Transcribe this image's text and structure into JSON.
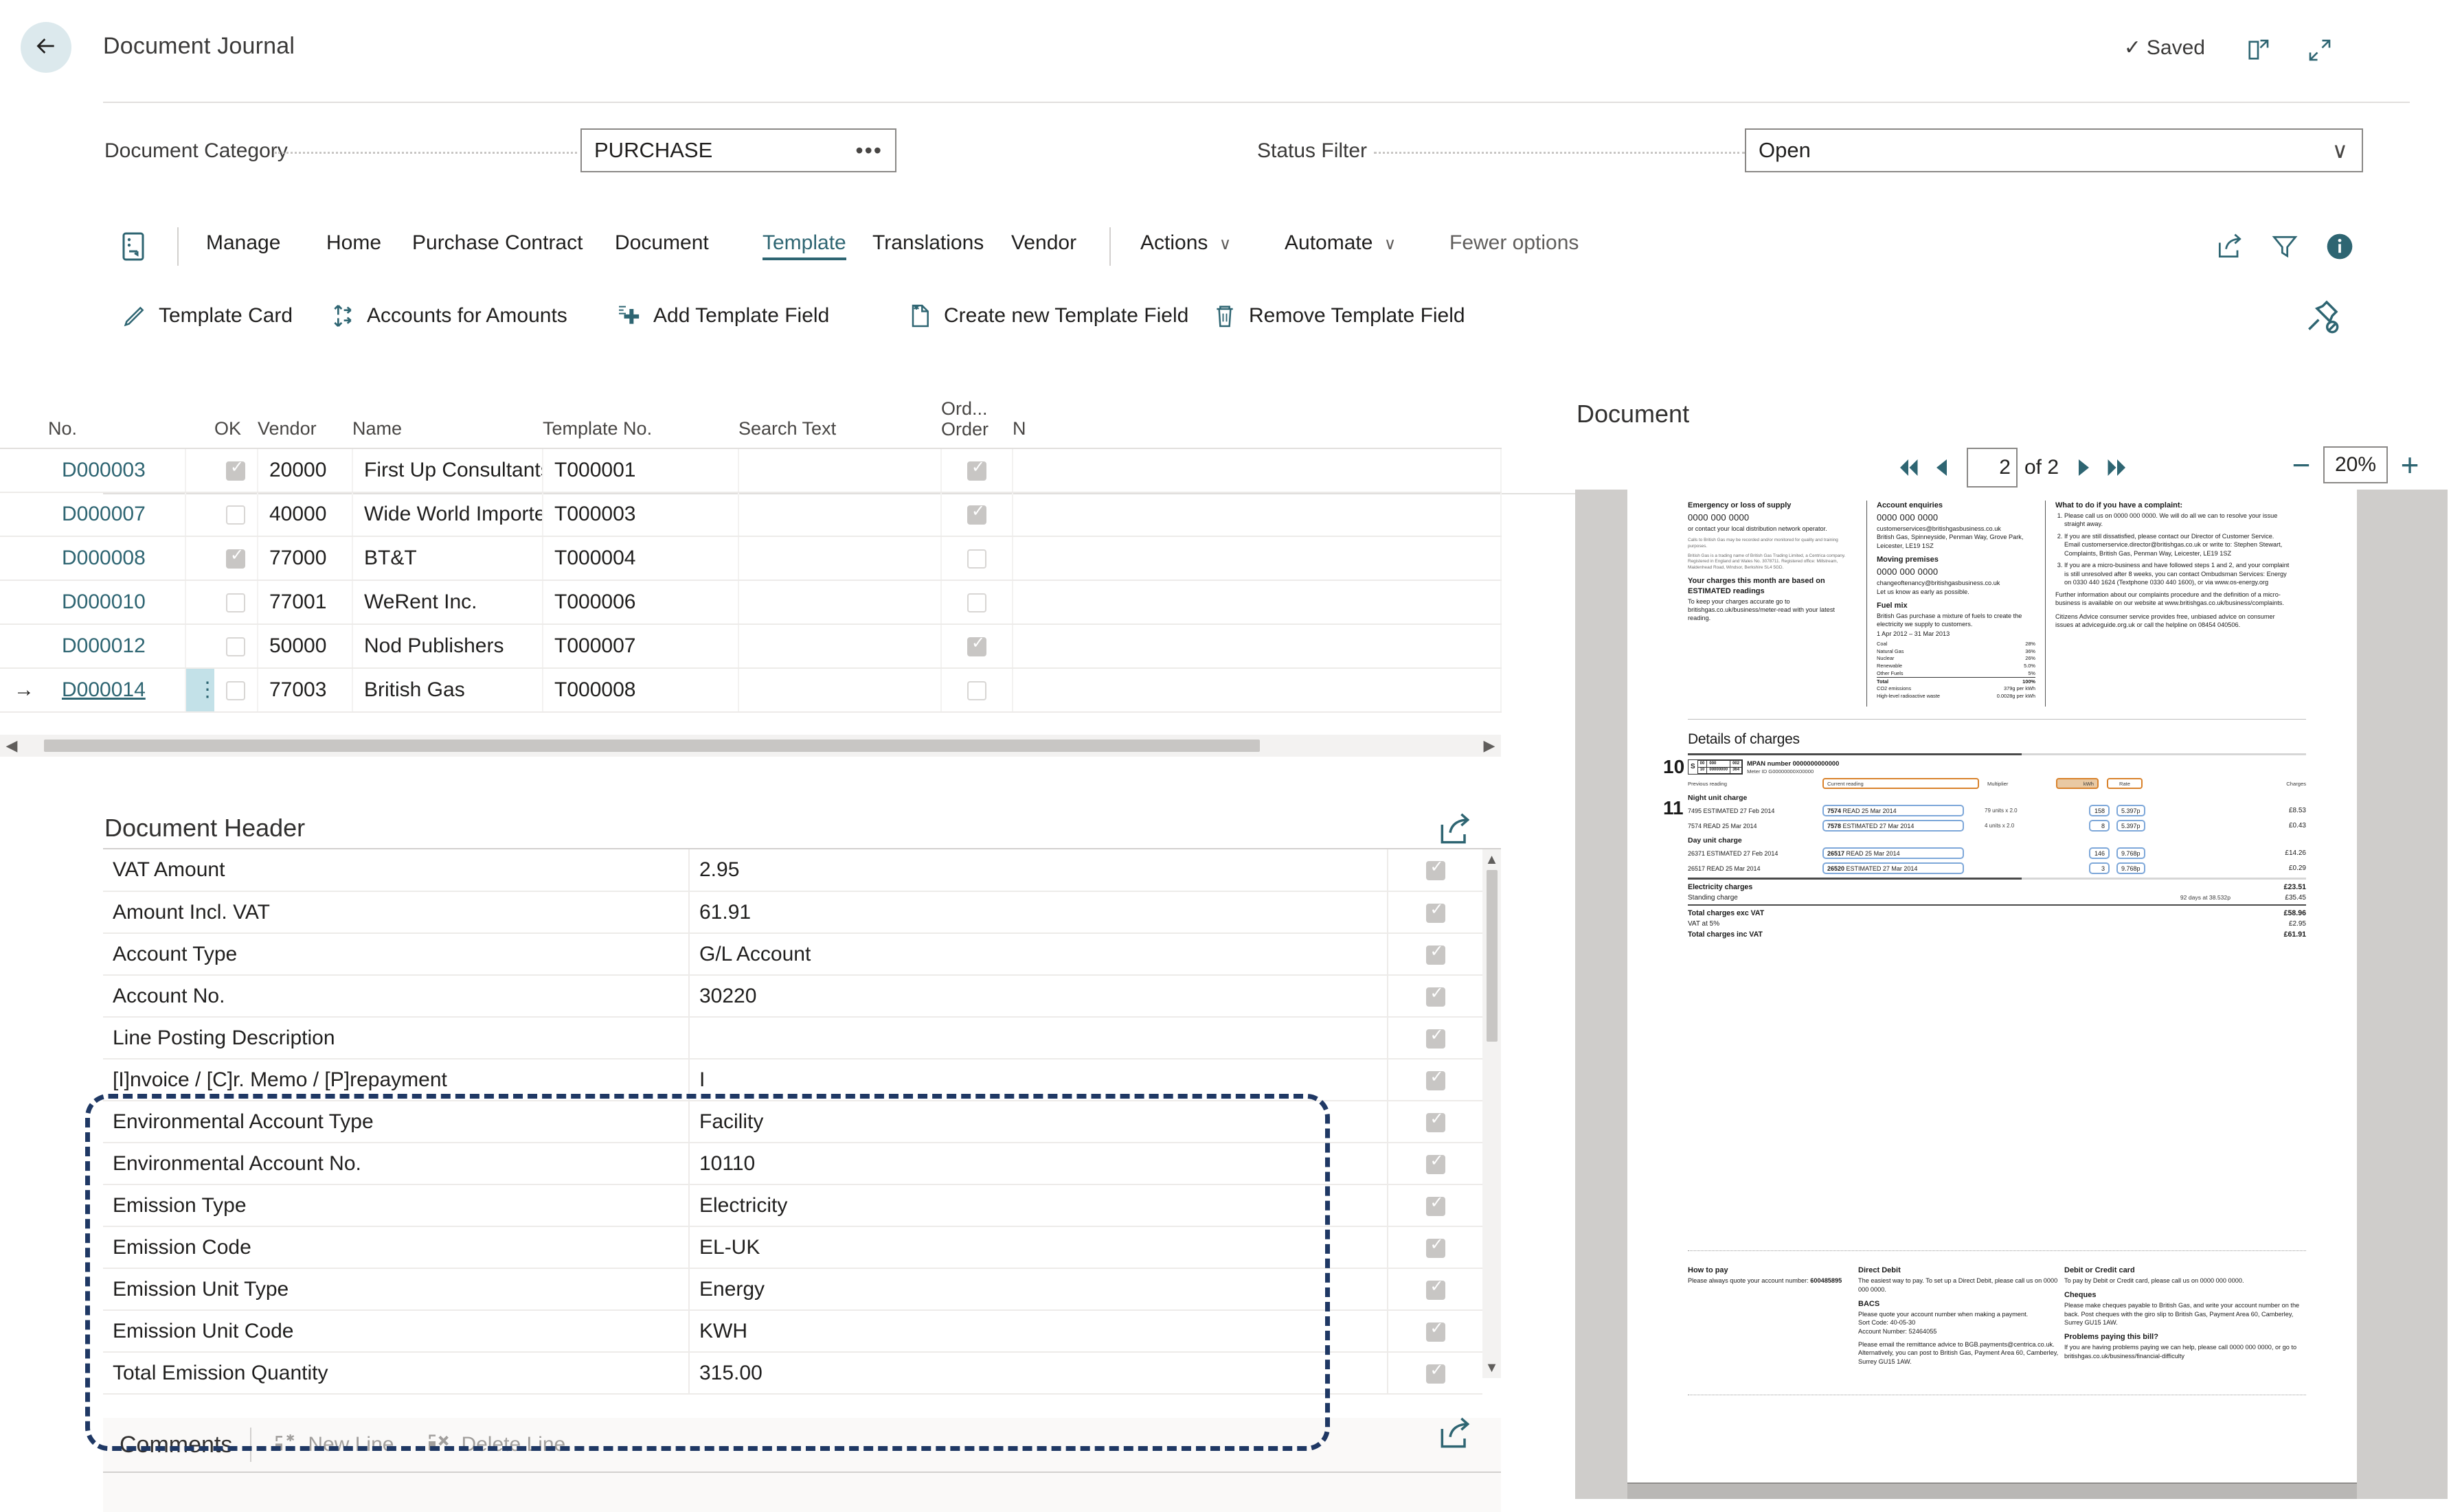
{
  "header": {
    "title": "Document Journal",
    "saved_label": "Saved",
    "back_icon": "arrow-left-icon",
    "open_new_icon": "open-in-new-window-icon",
    "collapse_icon": "collapse-icon"
  },
  "filters": [
    {
      "label": "Document Category",
      "value": "PURCHASE",
      "affordance": "•••",
      "kind": "lookup"
    },
    {
      "label": "Status Filter",
      "value": "Open",
      "affordance": "∨",
      "kind": "dropdown"
    }
  ],
  "ribbon": {
    "doc_icon": "document-actions-icon",
    "items": [
      {
        "label": "Manage",
        "state": "normal"
      },
      {
        "label": "Home",
        "state": "normal"
      },
      {
        "label": "Purchase Contract",
        "state": "normal"
      },
      {
        "label": "Document",
        "state": "normal"
      },
      {
        "label": "Template",
        "state": "active"
      },
      {
        "label": "Translations",
        "state": "normal"
      },
      {
        "label": "Vendor",
        "state": "normal"
      },
      {
        "label": "Actions",
        "state": "normal",
        "caret": "∨"
      },
      {
        "label": "Automate",
        "state": "normal",
        "caret": "∨"
      },
      {
        "label": "Fewer options",
        "state": "dim"
      }
    ],
    "right_icons": [
      "share-icon",
      "filter-icon",
      "info-icon"
    ]
  },
  "action_bar": {
    "actions": [
      {
        "label": "Template Card",
        "icon": "pencil-icon"
      },
      {
        "label": "Accounts for Amounts",
        "icon": "transfer-icon"
      },
      {
        "label": "Add Template Field",
        "icon": "add-field-icon"
      },
      {
        "label": "Create new Template Field",
        "icon": "new-document-icon"
      },
      {
        "label": "Remove Template Field",
        "icon": "trash-icon"
      }
    ],
    "unpin_icon": "unpin-icon"
  },
  "grid": {
    "columns": [
      "No.",
      "OK",
      "Vendor",
      "Name",
      "Template No.",
      "Search Text",
      "Ord...\nOrder",
      "N"
    ],
    "col_headers": {
      "no": "No.",
      "ok": "OK",
      "vendor": "Vendor",
      "name": "Name",
      "template_no": "Template No.",
      "search_text": "Search Text",
      "order_line1": "Ord...",
      "order_line2": "Order",
      "next": "N"
    },
    "rows": [
      {
        "arrow": "",
        "no": "D000003",
        "ok": true,
        "vendor": "20000",
        "name": "First Up Consultants",
        "template_no": "T000001",
        "search_text": "",
        "order": true,
        "selected": false
      },
      {
        "arrow": "",
        "no": "D000007",
        "ok": false,
        "vendor": "40000",
        "name": "Wide World Importers",
        "template_no": "T000003",
        "search_text": "",
        "order": true,
        "selected": false
      },
      {
        "arrow": "",
        "no": "D000008",
        "ok": true,
        "vendor": "77000",
        "name": "BT&T",
        "template_no": "T000004",
        "search_text": "",
        "order": false,
        "selected": false
      },
      {
        "arrow": "",
        "no": "D000010",
        "ok": false,
        "vendor": "77001",
        "name": "WeRent Inc.",
        "template_no": "T000006",
        "search_text": "",
        "order": false,
        "selected": false
      },
      {
        "arrow": "",
        "no": "D000012",
        "ok": false,
        "vendor": "50000",
        "name": "Nod Publishers",
        "template_no": "T000007",
        "search_text": "",
        "order": true,
        "selected": false
      },
      {
        "arrow": "→",
        "no": "D000014",
        "ok": false,
        "vendor": "77003",
        "name": "British Gas",
        "template_no": "T000008",
        "search_text": "",
        "order": false,
        "selected": true
      }
    ]
  },
  "document_header": {
    "title": "Document Header",
    "share_icon": "share-icon",
    "rows": [
      {
        "label": "VAT Amount",
        "value": "2.95",
        "checked": true,
        "highlighted": false
      },
      {
        "label": "Amount Incl. VAT",
        "value": "61.91",
        "checked": true,
        "highlighted": false
      },
      {
        "label": "Account Type",
        "value": "G/L Account",
        "checked": true,
        "highlighted": false
      },
      {
        "label": "Account No.",
        "value": "30220",
        "checked": true,
        "highlighted": false
      },
      {
        "label": "Line Posting Description",
        "value": "",
        "checked": true,
        "highlighted": false
      },
      {
        "label": "[I]nvoice / [C]r. Memo / [P]repayment",
        "value": "I",
        "checked": true,
        "highlighted": false
      },
      {
        "label": "Environmental Account Type",
        "value": "Facility",
        "checked": true,
        "highlighted": true
      },
      {
        "label": "Environmental Account No.",
        "value": "10110",
        "checked": true,
        "highlighted": true
      },
      {
        "label": "Emission Type",
        "value": "Electricity",
        "checked": true,
        "highlighted": true
      },
      {
        "label": "Emission Code",
        "value": "EL-UK",
        "checked": true,
        "highlighted": true
      },
      {
        "label": "Emission Unit Type",
        "value": "Energy",
        "checked": true,
        "highlighted": true
      },
      {
        "label": "Emission Unit Code",
        "value": "KWH",
        "checked": true,
        "highlighted": true
      },
      {
        "label": "Total Emission Quantity",
        "value": "315.00",
        "checked": true,
        "highlighted": true
      }
    ]
  },
  "comments": {
    "title": "Comments",
    "actions": [
      {
        "label": "New Line",
        "icon": "new-line-icon"
      },
      {
        "label": "Delete Line",
        "icon": "delete-line-icon"
      }
    ],
    "share_icon": "share-icon"
  },
  "document_panel": {
    "title": "Document",
    "pager": {
      "first_icon": "first-page-icon",
      "prev_icon": "prev-page-icon",
      "next_icon": "next-page-icon",
      "last_icon": "last-page-icon",
      "current_page": "2",
      "of_label": "of 2"
    },
    "zoom": {
      "minus": "−",
      "value": "20%",
      "plus": "+"
    }
  },
  "invoice": {
    "col1": {
      "h1": "Emergency or loss of supply",
      "phone1": "0000 000 0000",
      "p1": "or contact your local distribution network operator.",
      "tiny1": "Calls to British Gas may be recorded and/or monitored for quality and training purposes.",
      "tiny2": "British Gas is a trading name of British Gas Trading Limited, a Centrica company. Registered in England and Wales No. 3078711. Registered office: Millstream, Maidenhead Road, Windsor, Berkshire SL4 5GD.",
      "h2": "Your charges this month are based on ESTIMATED readings",
      "p2": "To keep your charges accurate go to britishgas.co.uk/business/meter-read with your latest reading."
    },
    "col2": {
      "h1": "Account enquiries",
      "phone1": "0000 000 0000",
      "email1": "customerservices@britishgasbusiness.co.uk",
      "addr1": "British Gas, Spinneyside, Penman Way, Grove Park, Leicester, LE19 1SZ",
      "h2": "Moving premises",
      "phone2": "0000 000 0000",
      "email2": "changeoftenancy@britishgasbusiness.co.uk",
      "p2": "Let us know as early as possible.",
      "h3": "Fuel mix",
      "p3": "British Gas purchase a mixture of fuels to create the electricity we supply to customers.",
      "fuel_period": "1 Apr 2012 – 31 Mar 2013",
      "fuel_rows": [
        {
          "name": "Coal",
          "pct": "28%"
        },
        {
          "name": "Natural Gas",
          "pct": "36%"
        },
        {
          "name": "Nuclear",
          "pct": "26%"
        },
        {
          "name": "Renewable",
          "pct": "5.0%"
        },
        {
          "name": "Other Fuels",
          "pct": "5%"
        },
        {
          "name": "Total",
          "pct": "100%"
        }
      ],
      "co2_label": "CO2 emissions",
      "co2_val": "379g per kWh",
      "waste_label": "High-level radioactive waste",
      "waste_val": "0.0028g per kWh"
    },
    "col3": {
      "h1": "What to do if you have a complaint:",
      "items": [
        "Please call us on 0000 000 0000. We will do all we can to resolve your issue straight away.",
        "If you are still dissatisfied, please contact our Director of Customer Service. Email customerservice.director@britishgas.co.uk or write to: Stephen Stewart, Complaints, British Gas, Penman Way, Leicester, LE19 1SZ",
        "If you are a micro-business and have followed steps 1 and 2, and your complaint is still unresolved after 8 weeks, you can contact Ombudsman Services: Energy on 0330 440 1624 (Textphone 0330 440 1600), or via www.os-energy.org"
      ],
      "p1": "Further information about our complaints procedure and the definition of a micro-business is available on our website at www.britishgas.co.uk/business/complaints.",
      "p2": "Citizens Advice consumer service provides free, unbiased advice on consumer issues at adviceguide.org.uk or call the helpline on 08454 040506."
    },
    "charges": {
      "title": "Details of charges",
      "step10": "10",
      "step11": "11",
      "mpan_row1": [
        "00",
        "000",
        "002"
      ],
      "mpan_row2": [
        "10",
        "00000000",
        "364"
      ],
      "mpan_s": "S",
      "mpan_label": "MPAN number 0000000000000",
      "meter_label": "Meter ID G00000000X00000",
      "hdr_prev": "Previous reading",
      "hdr_cur": "Current reading",
      "hdr_mult": "Multiplier",
      "hdr_kwh": "kWh",
      "hdr_rate": "Rate",
      "hdr_charges": "Charges",
      "night_title": "Night unit charge",
      "night_rows": [
        {
          "prev": "7495 ESTIMATED 27 Feb 2014",
          "cur_bold": "7574",
          "cur_rest": "READ 25 Mar 2014",
          "mult": "79 units x 2.0",
          "units": "158",
          "rate": "5.397p",
          "amt": "£8.53"
        },
        {
          "prev": "7574 READ 25 Mar 2014",
          "cur_bold": "7578",
          "cur_rest": "ESTIMATED 27 Mar 2014",
          "mult": "4 units x 2.0",
          "units": "8",
          "rate": "5.397p",
          "amt": "£0.43"
        }
      ],
      "day_title": "Day unit charge",
      "day_rows": [
        {
          "prev": "26371 ESTIMATED 27 Feb 2014",
          "cur_bold": "26517",
          "cur_rest": "READ 25 Mar 2014",
          "mult": "",
          "units": "146",
          "rate": "9.768p",
          "amt": "£14.26"
        },
        {
          "prev": "26517 READ 25 Mar 2014",
          "cur_bold": "26520",
          "cur_rest": "ESTIMATED 27 Mar 2014",
          "mult": "",
          "units": "3",
          "rate": "9.768p",
          "amt": "£0.29"
        }
      ],
      "totals": [
        {
          "label": "Electricity charges",
          "mid": "",
          "amt": "£23.51",
          "bold": true
        },
        {
          "label": "Standing charge",
          "mid": "92 days at 38.532p",
          "amt": "£35.45",
          "bold": false
        },
        {
          "label": "Total charges exc VAT",
          "mid": "",
          "amt": "£58.96",
          "bold": true
        },
        {
          "label": "VAT at 5%",
          "mid": "",
          "amt": "£2.95",
          "bold": false
        },
        {
          "label": "Total charges inc VAT",
          "mid": "",
          "amt": "£61.91",
          "bold": true
        }
      ]
    },
    "howpay": {
      "h1": "How to pay",
      "p1_a": "Please always quote your account number: ",
      "p1_num": "600485895",
      "dd_h": "Direct Debit",
      "dd_p": "The easiest way to pay. To set up a Direct Debit, please call us on 0000 000 0000.",
      "bacs_h": "BACS",
      "bacs_p1": "Please quote your account number when making a payment.",
      "bacs_sort": "Sort Code: 40-05-30",
      "bacs_acct": "Account Number: 52464055",
      "bacs_p2": "Please email the remittance advice to BGB.payments@centrica.co.uk. Alternatively, you can post to British Gas, Payment Area 60, Camberley, Surrey GU15 1AW.",
      "card_h": "Debit or Credit card",
      "card_p": "To pay by Debit or Credit card, please call us on 0000 000 0000.",
      "chq_h": "Cheques",
      "chq_p": "Please make cheques payable to British Gas, and write your account number on the back. Post cheques with the giro slip to British Gas, Payment Area 60, Camberley, Surrey GU15 1AW.",
      "prob_h": "Problems paying this bill?",
      "prob_p": "If you are having problems paying we can help, please call 0000 000 0000, or go to britishgas.co.uk/business/financial-difficulty"
    }
  }
}
